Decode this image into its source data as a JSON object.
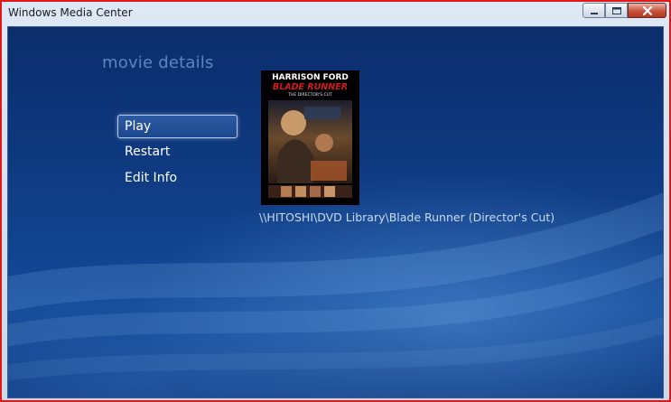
{
  "window": {
    "title": "Windows Media Center"
  },
  "page": {
    "heading": "movie details",
    "menu": [
      {
        "label": "Play",
        "selected": true
      },
      {
        "label": "Restart",
        "selected": false
      },
      {
        "label": "Edit Info",
        "selected": false
      }
    ]
  },
  "movie": {
    "poster": {
      "actor": "HARRISON FORD",
      "title": "BLADE RUNNER",
      "edition": "THE DIRECTOR'S CUT"
    },
    "path": "\\\\HITOSHI\\DVD Library\\Blade Runner (Director's Cut)"
  },
  "colors": {
    "frame_border": "#e01818",
    "background_dark": "#0b2d6c",
    "background_light": "#134a98",
    "heading": "#5f86bf",
    "path_text": "#c9dcf5"
  },
  "icons": [
    "minimize-icon",
    "maximize-icon",
    "close-icon"
  ]
}
